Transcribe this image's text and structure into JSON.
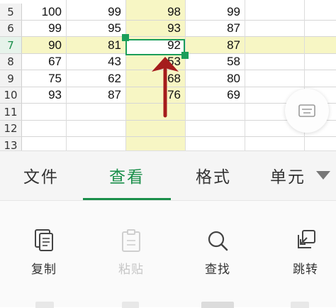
{
  "sheet": {
    "rows": [
      {
        "num": "5",
        "cells": [
          "100",
          "99",
          "98",
          "99"
        ]
      },
      {
        "num": "6",
        "cells": [
          "99",
          "95",
          "93",
          "87"
        ]
      },
      {
        "num": "7",
        "cells": [
          "90",
          "81",
          "92",
          "87"
        ]
      },
      {
        "num": "8",
        "cells": [
          "67",
          "43",
          "53",
          "58"
        ]
      },
      {
        "num": "9",
        "cells": [
          "75",
          "62",
          "68",
          "80"
        ]
      },
      {
        "num": "10",
        "cells": [
          "93",
          "87",
          "76",
          "69"
        ]
      },
      {
        "num": "11",
        "cells": [
          "",
          "",
          "",
          ""
        ]
      },
      {
        "num": "12",
        "cells": [
          "",
          "",
          "",
          ""
        ]
      },
      {
        "num": "13",
        "cells": [
          "",
          "",
          "",
          ""
        ]
      }
    ],
    "selected_row": "7",
    "highlight_color": "#f7f6c4",
    "selection_color": "#1b9e5a",
    "arrow_color": "#a51c1c"
  },
  "tabs": [
    {
      "label": "文件",
      "active": false
    },
    {
      "label": "查看",
      "active": true
    },
    {
      "label": "格式",
      "active": false
    },
    {
      "label": "单元",
      "active": false
    }
  ],
  "toolbar": {
    "copy": "复制",
    "paste": "粘贴",
    "find": "查找",
    "goto": "跳转"
  },
  "accent_color": "#1a8f4a"
}
